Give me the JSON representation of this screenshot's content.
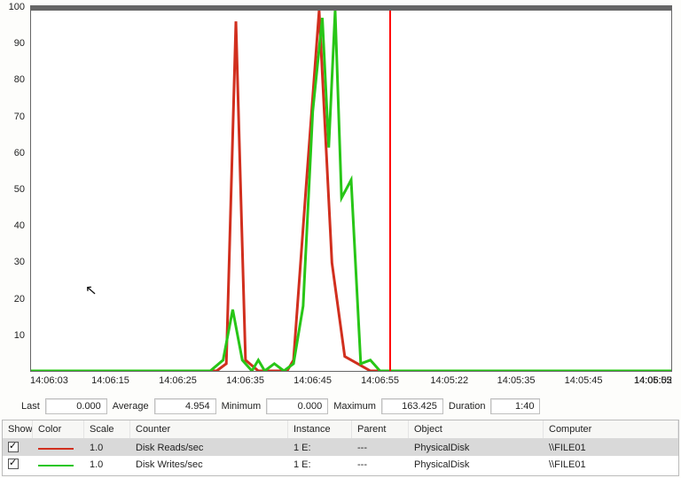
{
  "chart_data": {
    "type": "line",
    "x_labels": [
      "14:06:03",
      "14:06:15",
      "14:06:25",
      "14:06:35",
      "14:06:45",
      "14:06:55",
      "14:05:22",
      "14:05:35",
      "14:05:45",
      "14:05:55",
      "14:06:02"
    ],
    "x_fracs": [
      0.0,
      0.125,
      0.23,
      0.335,
      0.44,
      0.545,
      0.653,
      0.757,
      0.862,
      0.97,
      1.0
    ],
    "ylim": [
      0,
      100
    ],
    "y_ticks": [
      10,
      20,
      30,
      40,
      50,
      60,
      70,
      80,
      90,
      100
    ],
    "cursor_x_frac": 0.56,
    "series": [
      {
        "name": "Disk Reads/sec",
        "color": "#d12f1e",
        "points": [
          [
            0.0,
            0
          ],
          [
            0.29,
            0
          ],
          [
            0.305,
            2
          ],
          [
            0.32,
            97
          ],
          [
            0.335,
            3
          ],
          [
            0.355,
            0
          ],
          [
            0.4,
            0
          ],
          [
            0.41,
            3
          ],
          [
            0.43,
            52
          ],
          [
            0.45,
            100
          ],
          [
            0.47,
            30
          ],
          [
            0.49,
            4
          ],
          [
            0.51,
            2
          ],
          [
            0.53,
            0
          ],
          [
            1.0,
            0
          ]
        ]
      },
      {
        "name": "Disk Writes/sec",
        "color": "#28c617",
        "points": [
          [
            0.0,
            0
          ],
          [
            0.28,
            0
          ],
          [
            0.3,
            3
          ],
          [
            0.315,
            17
          ],
          [
            0.33,
            3
          ],
          [
            0.345,
            0
          ],
          [
            0.355,
            3
          ],
          [
            0.365,
            0
          ],
          [
            0.38,
            2
          ],
          [
            0.395,
            0
          ],
          [
            0.41,
            2
          ],
          [
            0.425,
            18
          ],
          [
            0.44,
            72
          ],
          [
            0.455,
            98
          ],
          [
            0.465,
            62
          ],
          [
            0.475,
            100
          ],
          [
            0.485,
            48
          ],
          [
            0.5,
            53
          ],
          [
            0.515,
            2
          ],
          [
            0.53,
            3
          ],
          [
            0.545,
            0
          ],
          [
            1.0,
            0
          ]
        ]
      }
    ]
  },
  "stats": {
    "last_label": "Last",
    "last": "0.000",
    "avg_label": "Average",
    "avg": "4.954",
    "min_label": "Minimum",
    "min": "0.000",
    "max_label": "Maximum",
    "max": "163.425",
    "dur_label": "Duration",
    "dur": "1:40"
  },
  "legend": {
    "headers": {
      "show": "Show",
      "color": "Color",
      "scale": "Scale",
      "counter": "Counter",
      "instance": "Instance",
      "parent": "Parent",
      "object": "Object",
      "computer": "Computer"
    },
    "rows": [
      {
        "selected": true,
        "color": "#d12f1e",
        "scale": "1.0",
        "counter": "Disk Reads/sec",
        "instance": "1 E:",
        "parent": "---",
        "object": "PhysicalDisk",
        "computer": "\\\\FILE01"
      },
      {
        "selected": false,
        "color": "#28c617",
        "scale": "1.0",
        "counter": "Disk Writes/sec",
        "instance": "1 E:",
        "parent": "---",
        "object": "PhysicalDisk",
        "computer": "\\\\FILE01"
      }
    ]
  }
}
